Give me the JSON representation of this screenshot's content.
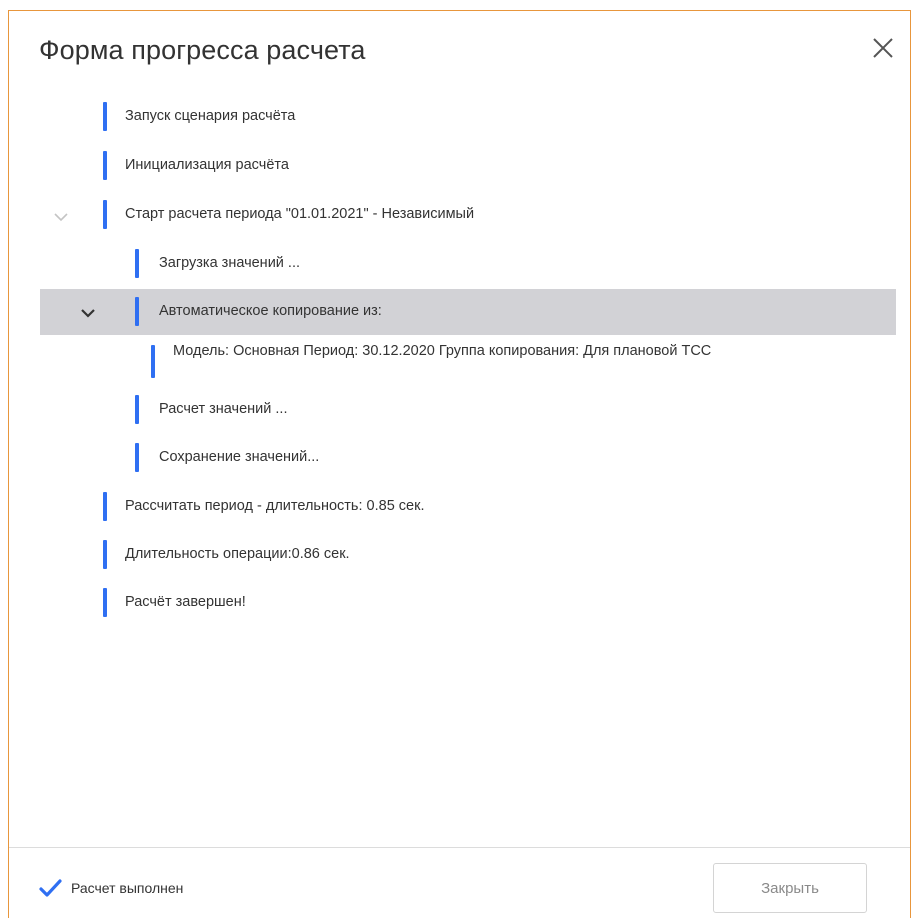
{
  "dialog": {
    "title": "Форма прогресса расчета",
    "close_icon": "close-icon"
  },
  "log": [
    {
      "text": "Запуск сценария расчёта",
      "level": 0,
      "chevron": "none",
      "selected": false
    },
    {
      "text": "Инициализация расчёта",
      "level": 0,
      "chevron": "none",
      "selected": false
    },
    {
      "text": "Старт расчета периода \"01.01.2021\" - Независимый",
      "level": 0,
      "chevron": "collapsed",
      "selected": false
    },
    {
      "text": "Загрузка значений ...",
      "level": 1,
      "chevron": "none",
      "selected": false
    },
    {
      "text": "Автоматическое копирование из:",
      "level": 1,
      "chevron": "expanded",
      "selected": true
    },
    {
      "text": "Модель: Основная Период: 30.12.2020 Группа копирования: Для плановой ТСС",
      "level": 2,
      "chevron": "none",
      "selected": false
    },
    {
      "text": "Расчет значений ...",
      "level": 1,
      "chevron": "none",
      "selected": false
    },
    {
      "text": "Сохранение значений...",
      "level": 1,
      "chevron": "none",
      "selected": false
    },
    {
      "text": "Рассчитать период - длительность: 0.85 сек.",
      "level": 0,
      "chevron": "none",
      "selected": false
    },
    {
      "text": "Длительность операции:0.86 сек.",
      "level": 0,
      "chevron": "none",
      "selected": false
    },
    {
      "text": "Расчёт завершен!",
      "level": 0,
      "chevron": "none",
      "selected": false
    }
  ],
  "footer": {
    "status_text": "Расчет выполнен",
    "status_icon": "checkmark-icon",
    "close_label": "Закрыть"
  },
  "colors": {
    "accent_bar": "#2f6ff2",
    "dialog_border": "#e8963c",
    "selected_row": "#d2d2d6",
    "status_check": "#2f6ff2"
  }
}
